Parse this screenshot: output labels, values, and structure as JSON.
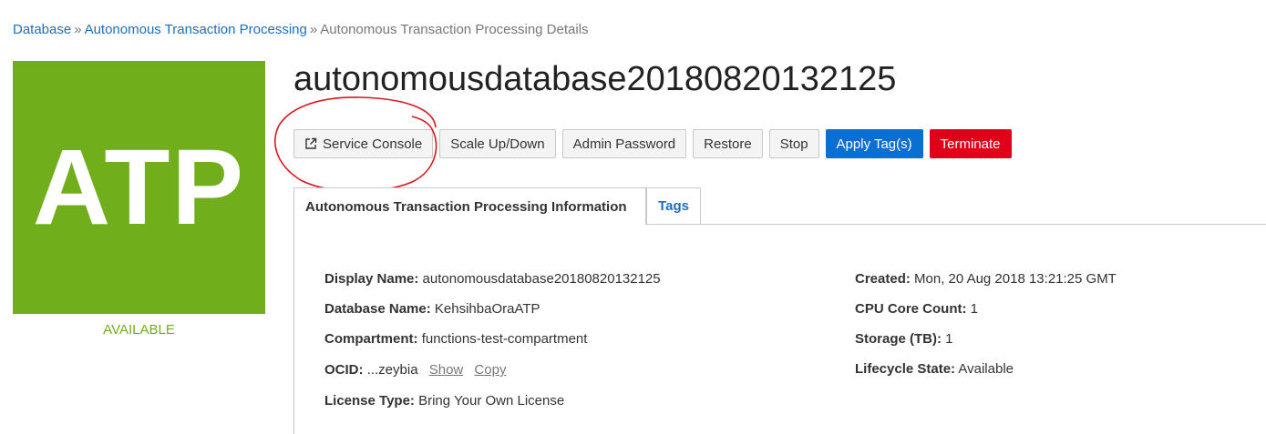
{
  "breadcrumb": {
    "items": [
      "Database",
      "Autonomous Transaction Processing"
    ],
    "separator": "»",
    "current": "Autonomous Transaction Processing Details"
  },
  "logo": {
    "text": "ATP",
    "color": "#70ae1b"
  },
  "status": "AVAILABLE",
  "title": "autonomousdatabase20180820132125",
  "actions": {
    "service_console": "Service Console",
    "scale": "Scale Up/Down",
    "admin_password": "Admin Password",
    "restore": "Restore",
    "stop": "Stop",
    "apply_tags": "Apply Tag(s)",
    "terminate": "Terminate"
  },
  "tabs": {
    "info": "Autonomous Transaction Processing Information",
    "tags": "Tags"
  },
  "info": {
    "display_name": {
      "label": "Display Name:",
      "value": "autonomousdatabase20180820132125"
    },
    "database_name": {
      "label": "Database Name:",
      "value": "KehsihbaOraATP"
    },
    "compartment": {
      "label": "Compartment:",
      "value": "functions-test-compartment"
    },
    "ocid": {
      "label": "OCID:",
      "value": "...zeybia",
      "show": "Show",
      "copy": "Copy"
    },
    "license_type": {
      "label": "License Type:",
      "value": "Bring Your Own License"
    },
    "created": {
      "label": "Created:",
      "value": "Mon, 20 Aug 2018 13:21:25 GMT"
    },
    "cpu_core_count": {
      "label": "CPU Core Count:",
      "value": "1"
    },
    "storage": {
      "label": "Storage (TB):",
      "value": "1"
    },
    "lifecycle_state": {
      "label": "Lifecycle State:",
      "value": "Available"
    }
  },
  "colors": {
    "link": "#1f6fbf",
    "primary": "#0a6fd1",
    "danger": "#e1001a",
    "annotation": "#d9161e"
  }
}
